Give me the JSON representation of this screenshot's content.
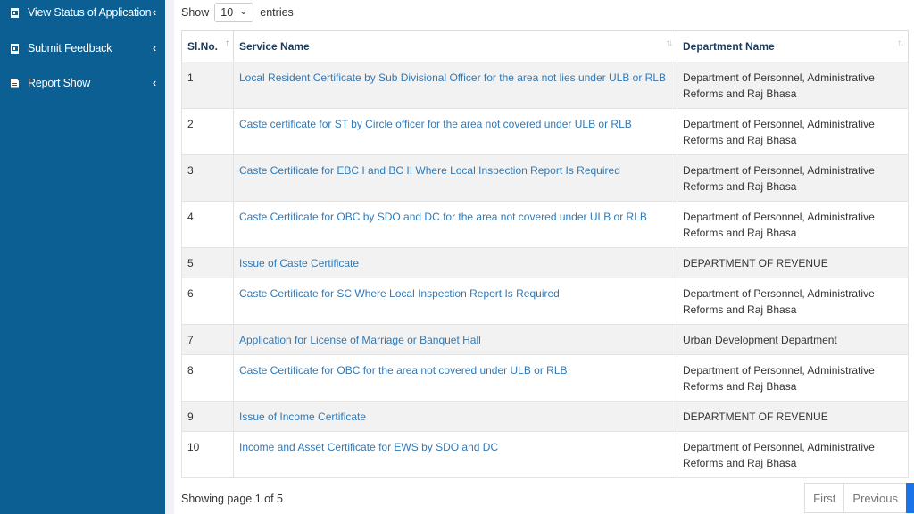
{
  "sidebar": {
    "items": [
      {
        "label": "View Status of Application",
        "icon": "hourglass-icon"
      },
      {
        "label": "Submit Feedback",
        "icon": "hourglass-icon"
      },
      {
        "label": "Report Show",
        "icon": "file-icon"
      }
    ],
    "chevron": "‹"
  },
  "length_menu": {
    "show": "Show",
    "value": "10",
    "entries": "entries",
    "caret": "⌄"
  },
  "table": {
    "headers": {
      "sl": "Sl.No.",
      "service": "Service Name",
      "department": "Department Name"
    },
    "rows": [
      {
        "no": "1",
        "service": "Local Resident Certificate by Sub Divisional Officer for the area not lies under ULB or RLB",
        "department": "Department of Personnel, Administrative Reforms and Raj Bhasa"
      },
      {
        "no": "2",
        "service": "Caste certificate for ST by Circle officer for the area not covered under ULB or RLB",
        "department": "Department of Personnel, Administrative Reforms and Raj Bhasa"
      },
      {
        "no": "3",
        "service": "Caste Certificate for EBC I and BC II Where Local Inspection Report Is Required",
        "department": "Department of Personnel, Administrative Reforms and Raj Bhasa"
      },
      {
        "no": "4",
        "service": "Caste Certificate for OBC by SDO and DC for the area not covered under ULB or RLB",
        "department": "Department of Personnel, Administrative Reforms and Raj Bhasa"
      },
      {
        "no": "5",
        "service": "Issue of Caste Certificate",
        "department": "DEPARTMENT OF REVENUE"
      },
      {
        "no": "6",
        "service": "Caste Certificate for SC Where Local Inspection Report Is Required",
        "department": "Department of Personnel, Administrative Reforms and Raj Bhasa"
      },
      {
        "no": "7",
        "service": "Application for License of Marriage or Banquet Hall",
        "department": "Urban Development Department"
      },
      {
        "no": "8",
        "service": "Caste Certificate for OBC for the area not covered under ULB or RLB",
        "department": "Department of Personnel, Administrative Reforms and Raj Bhasa"
      },
      {
        "no": "9",
        "service": "Issue of Income Certificate",
        "department": "DEPARTMENT OF REVENUE"
      },
      {
        "no": "10",
        "service": "Income and Asset Certificate for EWS by SDO and DC",
        "department": "Department of Personnel, Administrative Reforms and Raj Bhasa"
      }
    ]
  },
  "footer": {
    "info": "Showing page 1 of 5",
    "first": "First",
    "previous": "Previous"
  },
  "colors": {
    "sidebar": "#0c5f93",
    "link": "#2f7ab8",
    "active": "#1a73e8"
  }
}
